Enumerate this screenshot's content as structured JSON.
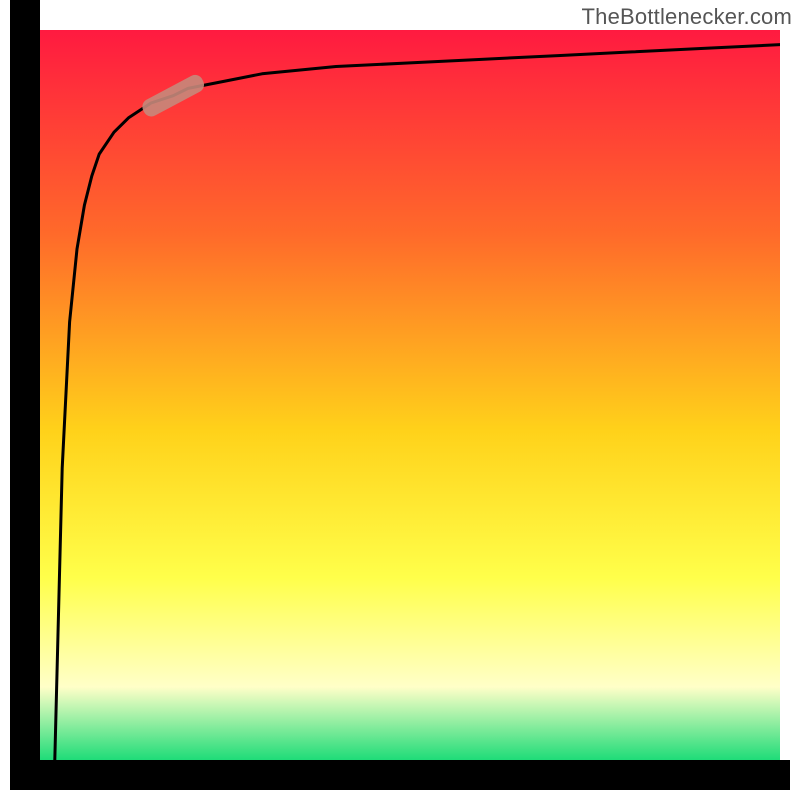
{
  "watermark": {
    "text": "TheBottlenecker.com"
  },
  "colors": {
    "frame": "#000000",
    "gradient_top": "#ff1a40",
    "gradient_mid_top": "#ff6a2a",
    "gradient_mid": "#ffd21a",
    "gradient_low": "#ffff4a",
    "gradient_pale": "#ffffc8",
    "gradient_bottom": "#1edc78",
    "curve": "#000000",
    "marker": "#c7887b"
  },
  "chart_data": {
    "type": "line",
    "title": "",
    "xlabel": "",
    "ylabel": "",
    "xlim": [
      0,
      100
    ],
    "ylim": [
      0,
      100
    ],
    "series": [
      {
        "name": "curve",
        "x": [
          2,
          3,
          4,
          5,
          6,
          7,
          8,
          10,
          12,
          15,
          18,
          20,
          25,
          30,
          40,
          50,
          60,
          70,
          80,
          90,
          100
        ],
        "y": [
          0,
          40,
          60,
          70,
          76,
          80,
          83,
          86,
          88,
          90,
          91,
          92,
          93,
          94,
          95,
          95.5,
          96,
          96.5,
          97,
          97.5,
          98
        ]
      }
    ],
    "marker": {
      "x_center": 18,
      "y_center": 91,
      "shape": "pill",
      "length": 9,
      "width": 3,
      "angle_deg": -28
    },
    "grid": false,
    "legend": {
      "visible": false
    },
    "axes": {
      "ticks_visible": false,
      "frame_top": false,
      "frame_right": false,
      "frame_left": true,
      "frame_bottom": true
    }
  }
}
